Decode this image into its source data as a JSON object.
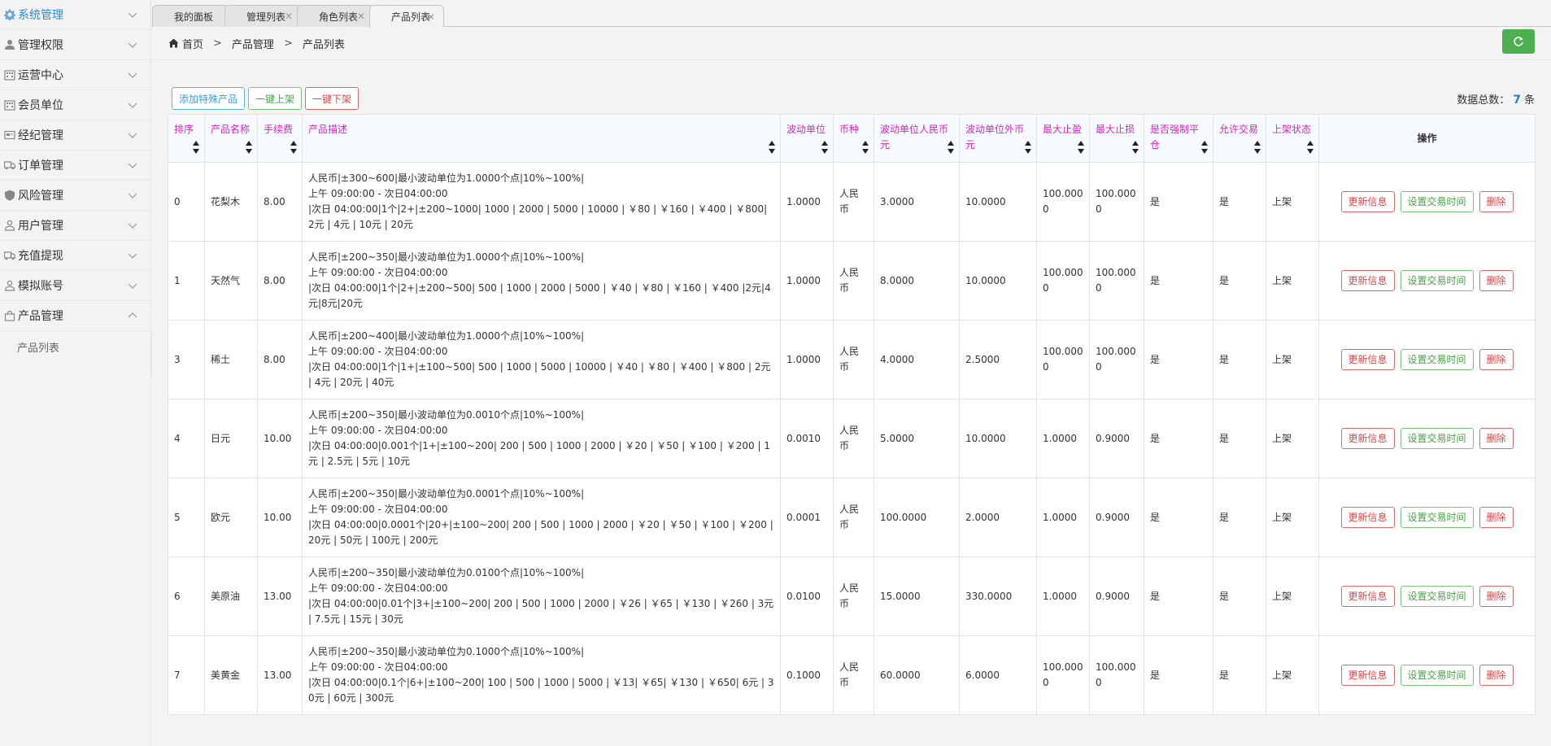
{
  "sidebar": {
    "items": [
      {
        "label": "系统管理",
        "icon": "gear-icon",
        "active": true
      },
      {
        "label": "管理权限",
        "icon": "user-icon"
      },
      {
        "label": "运营中心",
        "icon": "building-icon"
      },
      {
        "label": "会员单位",
        "icon": "building-icon"
      },
      {
        "label": "经纪管理",
        "icon": "card-icon"
      },
      {
        "label": "订单管理",
        "icon": "truck-icon"
      },
      {
        "label": "风险管理",
        "icon": "shield-icon"
      },
      {
        "label": "用户管理",
        "icon": "user-outline-icon"
      },
      {
        "label": "充值提现",
        "icon": "truck-icon"
      },
      {
        "label": "模拟账号",
        "icon": "user-outline-icon"
      },
      {
        "label": "产品管理",
        "icon": "bag-icon",
        "expanded": true
      }
    ],
    "submenu": [
      "产品列表"
    ]
  },
  "tabs": [
    {
      "label": "我的面板",
      "closable": false
    },
    {
      "label": "管理列表",
      "closable": true
    },
    {
      "label": "角色列表",
      "closable": true
    },
    {
      "label": "产品列表",
      "closable": true,
      "active": true
    }
  ],
  "breadcrumb": {
    "home": "首页",
    "sep": ">",
    "level1": "产品管理",
    "level2": "产品列表"
  },
  "toolbar": {
    "add_label": "添加特殊产品",
    "up_label": "一键上架",
    "down_label": "一键下架"
  },
  "total": {
    "prefix": "数据总数：",
    "count": "7",
    "suffix": "条"
  },
  "table": {
    "headers": [
      "排序",
      "产品名称",
      "手续费",
      "产品描述",
      "波动单位",
      "币种",
      "波动单位人民币元",
      "波动单位外币元",
      "最大止盈",
      "最大止损",
      "是否强制平仓",
      "允许交易",
      "上架状态",
      "操作"
    ],
    "op_labels": {
      "update": "更新信息",
      "time": "设置交易时间",
      "delete": "删除"
    },
    "rows": [
      {
        "sort": "0",
        "name": "花梨木",
        "fee": "8.00",
        "desc": [
          "人民币|±300~600|最小波动单位为1.0000个点|10%~100%|",
          "上午 09:00:00 - 次日04:00:00",
          "|次日 04:00:00|1个|2+|±200~1000| 1000 | 2000 | 5000 | 10000 | ￥80 | ￥160 | ￥400 | ￥800| 2元 | 4元 | 10元 | 20元"
        ],
        "unit": "1.0000",
        "currency": "人民币",
        "cny_unit": "3.0000",
        "fx_unit": "10.0000",
        "max_profit": "100.0000",
        "max_loss": "100.0000",
        "force_close": "是",
        "allow_trade": "是",
        "status": "上架"
      },
      {
        "sort": "1",
        "name": "天然气",
        "fee": "8.00",
        "desc": [
          "人民币|±200~350|最小波动单位为1.0000个点|10%~100%|",
          "上午 09:00:00 - 次日04:00:00",
          "|次日 04:00:00|1个|2+|±200~500| 500 | 1000 | 2000 | 5000 | ￥40 | ￥80 | ￥160 | ￥400 |2元|4元|8元|20元"
        ],
        "unit": "1.0000",
        "currency": "人民币",
        "cny_unit": "8.0000",
        "fx_unit": "10.0000",
        "max_profit": "100.0000",
        "max_loss": "100.0000",
        "force_close": "是",
        "allow_trade": "是",
        "status": "上架"
      },
      {
        "sort": "3",
        "name": "稀土",
        "fee": "8.00",
        "desc": [
          "人民币|±200~400|最小波动单位为1.0000个点|10%~100%|",
          "上午 09:00:00 - 次日04:00:00",
          "|次日 04:00:00|1个|1+|±100~500| 500 | 1000 | 5000 | 10000 | ￥40 | ￥80 | ￥400 | ￥800 | 2元 | 4元 | 20元 | 40元"
        ],
        "unit": "1.0000",
        "currency": "人民币",
        "cny_unit": "4.0000",
        "fx_unit": "2.5000",
        "max_profit": "100.0000",
        "max_loss": "100.0000",
        "force_close": "是",
        "allow_trade": "是",
        "status": "上架"
      },
      {
        "sort": "4",
        "name": "日元",
        "fee": "10.00",
        "desc": [
          "人民币|±200~350|最小波动单位为0.0010个点|10%~100%|",
          "上午 09:00:00 - 次日04:00:00",
          "|次日 04:00:00|0.001个|1+|±100~200| 200 | 500 | 1000 | 2000 | ￥20 | ￥50 | ￥100 | ￥200 | 1元 | 2.5元 | 5元 | 10元"
        ],
        "unit": "0.0010",
        "currency": "人民币",
        "cny_unit": "5.0000",
        "fx_unit": "10.0000",
        "max_profit": "1.0000",
        "max_loss": "0.9000",
        "force_close": "是",
        "allow_trade": "是",
        "status": "上架"
      },
      {
        "sort": "5",
        "name": "欧元",
        "fee": "10.00",
        "desc": [
          "人民币|±200~350|最小波动单位为0.0001个点|10%~100%|",
          "上午 09:00:00 - 次日04:00:00",
          "|次日 04:00:00|0.0001个|20+|±100~200| 200 | 500 | 1000 | 2000 | ￥20 | ￥50 | ￥100 | ￥200 | 20元 | 50元 | 100元 | 200元"
        ],
        "unit": "0.0001",
        "currency": "人民币",
        "cny_unit": "100.0000",
        "fx_unit": "2.0000",
        "max_profit": "1.0000",
        "max_loss": "0.9000",
        "force_close": "是",
        "allow_trade": "是",
        "status": "上架"
      },
      {
        "sort": "6",
        "name": "美原油",
        "fee": "13.00",
        "desc": [
          "人民币|±200~350|最小波动单位为0.0100个点|10%~100%|",
          "上午 09:00:00 - 次日04:00:00",
          "|次日 04:00:00|0.01个|3+|±100~200| 200 | 500 | 1000 | 2000 | ￥26 | ￥65 | ￥130 | ￥260 | 3元 | 7.5元 | 15元 | 30元"
        ],
        "unit": "0.0100",
        "currency": "人民币",
        "cny_unit": "15.0000",
        "fx_unit": "330.0000",
        "max_profit": "1.0000",
        "max_loss": "0.9000",
        "force_close": "是",
        "allow_trade": "是",
        "status": "上架"
      },
      {
        "sort": "7",
        "name": "美黄金",
        "fee": "13.00",
        "desc": [
          "人民币|±200~350|最小波动单位为0.1000个点|10%~100%|",
          "上午 09:00:00 - 次日04:00:00",
          "|次日 04:00:00|0.1个|6+|±100~200| 100 | 500 | 1000 | 5000 | ￥13| ￥65| ￥130 | ￥650| 6元 | 30元 | 60元 | 300元"
        ],
        "unit": "0.1000",
        "currency": "人民币",
        "cny_unit": "60.0000",
        "fx_unit": "6.0000",
        "max_profit": "100.0000",
        "max_loss": "100.0000",
        "force_close": "是",
        "allow_trade": "是",
        "status": "上架"
      }
    ]
  },
  "colors": {
    "accent": "#2a8ad8",
    "header_text": "#e020c0",
    "success": "#4caf50",
    "danger": "#d84a4a",
    "info": "#3a9ed8"
  }
}
